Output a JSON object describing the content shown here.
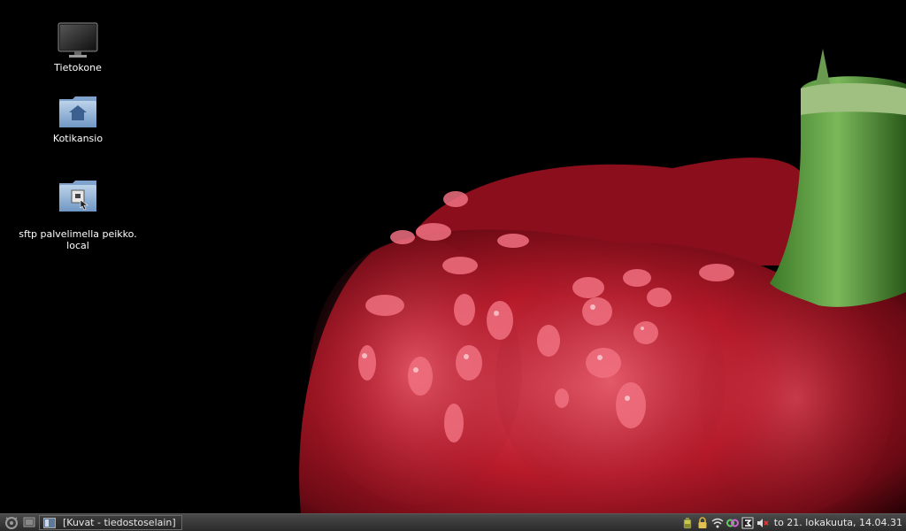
{
  "desktop": {
    "icons": [
      {
        "label": "Tietokone",
        "icon": "computer-monitor-icon"
      },
      {
        "label": "Kotikansio",
        "icon": "home-folder-icon"
      },
      {
        "label": "sftp palvelimella peikko.\nlocal",
        "icon": "network-folder-icon"
      }
    ]
  },
  "taskbar": {
    "start_icon": "menu-logo-icon",
    "show_desktop_icon": "show-desktop-icon",
    "task": {
      "label": "[Kuvat - tiedostoselain]",
      "icon": "file-manager-icon"
    },
    "tray_icons": [
      "battery-icon",
      "lock-icon",
      "wifi-icon",
      "network-rings-icon",
      "keyboard-layout-icon",
      "volume-muted-icon"
    ],
    "clock": "to 21. lokakuuta, 14.04.31"
  },
  "colors": {
    "taskbar_bg": "#3a3a3a",
    "pepper_red": "#c41e2e",
    "stem_green": "#5a9a3a"
  }
}
